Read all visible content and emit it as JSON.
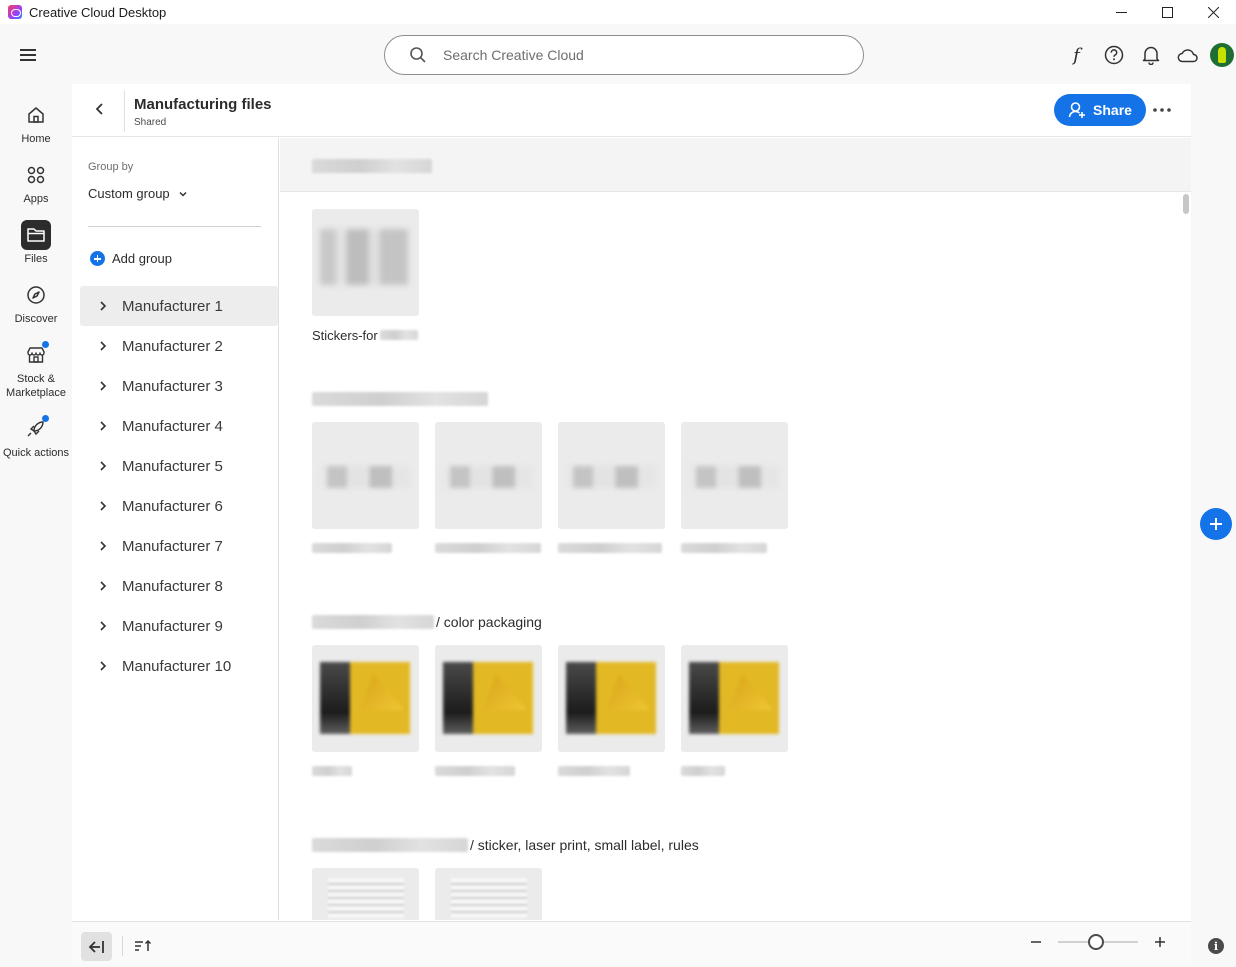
{
  "window": {
    "title": "Creative Cloud Desktop",
    "minimize": "—",
    "maximize": "☐",
    "close": "✕"
  },
  "search": {
    "placeholder": "Search Creative Cloud"
  },
  "topbar": {
    "font_icon": "f"
  },
  "nav": [
    {
      "label": "Home",
      "icon": "home-icon"
    },
    {
      "label": "Apps",
      "icon": "apps-icon"
    },
    {
      "label": "Files",
      "icon": "folder-icon",
      "active": true
    },
    {
      "label": "Discover",
      "icon": "compass-icon"
    },
    {
      "label": "Stock & Marketplace",
      "icon": "store-icon",
      "badge": true
    },
    {
      "label": "Quick actions",
      "icon": "rocket-icon",
      "badge": true
    }
  ],
  "panel": {
    "title": "Manufacturing files",
    "subtitle": "Shared",
    "share_label": "Share"
  },
  "groupbar": {
    "group_by_label": "Group by",
    "group_by_value": "Custom group",
    "add_group_label": "Add group",
    "groups": [
      "Manufacturer 1",
      "Manufacturer 2",
      "Manufacturer 3",
      "Manufacturer 4",
      "Manufacturer 5",
      "Manufacturer 6",
      "Manufacturer 7",
      "Manufacturer 8",
      "Manufacturer 9",
      "Manufacturer 10"
    ],
    "selected_index": 0
  },
  "sections": {
    "s1": {
      "tile_name": "Stickers-for"
    },
    "s3": {
      "title_suffix": "/ color packaging"
    },
    "s4": {
      "title_suffix": "/ sticker, laser print, small label, rules"
    }
  },
  "colors": {
    "accent": "#1473e6",
    "tile_bg": "#ebebeb",
    "yellow": "#e2b824"
  }
}
